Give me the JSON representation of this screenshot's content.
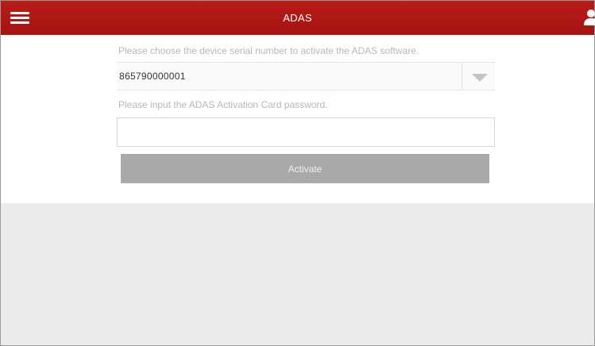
{
  "header": {
    "title": "ADAS",
    "menu_icon": "hamburger-menu-icon",
    "user_icon": "user-icon"
  },
  "form": {
    "serial_prompt": "Please choose the device serial number to activate the ADAS software.",
    "serial_value": "865790000001",
    "password_prompt": "Please input the ADAS Activation Card password.",
    "password_value": "",
    "activate_label": "Activate"
  },
  "colors": {
    "header_bg": "#b01815",
    "button_bg": "#a9a9a9",
    "page_bg": "#ebebeb"
  }
}
